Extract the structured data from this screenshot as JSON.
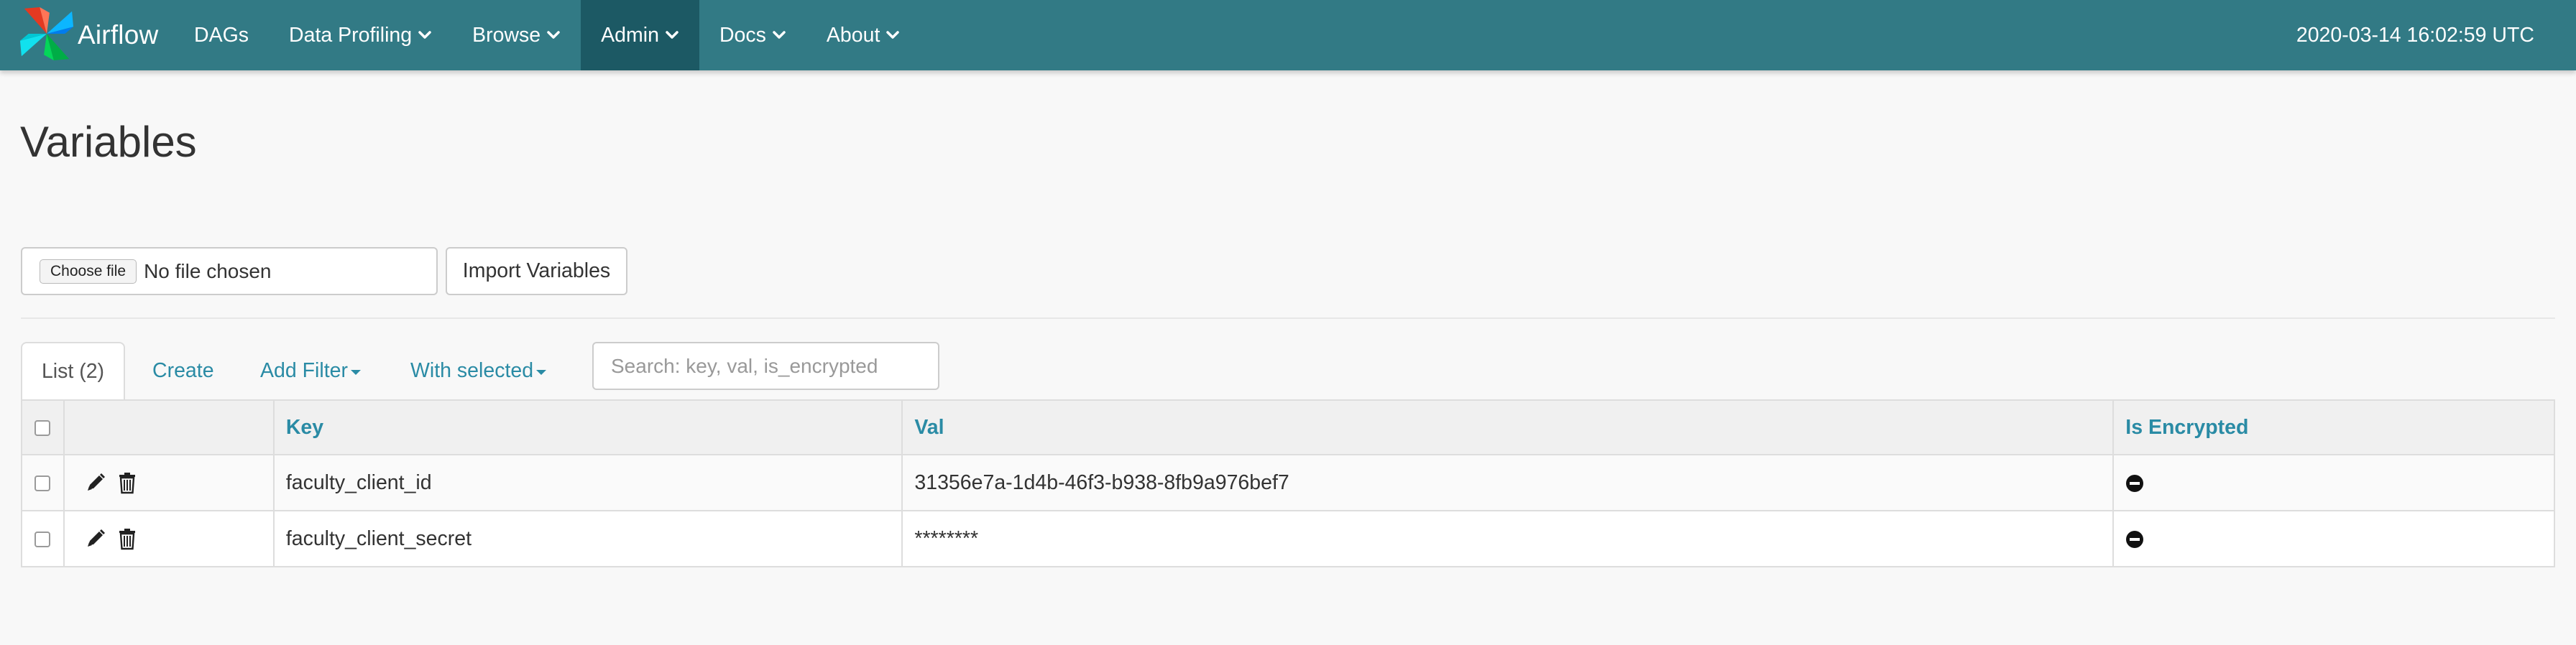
{
  "navbar": {
    "brand": "Airflow",
    "items": [
      {
        "label": "DAGs",
        "dropdown": false,
        "active": false
      },
      {
        "label": "Data Profiling",
        "dropdown": true,
        "active": false
      },
      {
        "label": "Browse",
        "dropdown": true,
        "active": false
      },
      {
        "label": "Admin",
        "dropdown": true,
        "active": true
      },
      {
        "label": "Docs",
        "dropdown": true,
        "active": false
      },
      {
        "label": "About",
        "dropdown": true,
        "active": false
      }
    ],
    "clock": "2020-03-14 16:02:59 UTC"
  },
  "page": {
    "title": "Variables"
  },
  "import": {
    "choose_file": "Choose file",
    "file_status": "No file chosen",
    "import_button": "Import Variables"
  },
  "tabs": {
    "list": "List (2)",
    "create": "Create",
    "add_filter": "Add Filter",
    "with_selected": "With selected"
  },
  "search": {
    "placeholder": "Search: key, val, is_encrypted",
    "value": ""
  },
  "table": {
    "columns": [
      "Key",
      "Val",
      "Is Encrypted"
    ],
    "rows": [
      {
        "key": "faculty_client_id",
        "val": "31356e7a-1d4b-46f3-b938-8fb9a976bef7",
        "is_encrypted_icon": "minus-circle-icon"
      },
      {
        "key": "faculty_client_secret",
        "val": "********",
        "is_encrypted_icon": "minus-circle-icon"
      }
    ]
  },
  "colors": {
    "navbar": "#327a85",
    "navbar_active": "#1c5964",
    "link": "#2a8ba5",
    "page_bg": "#f8f8f8"
  },
  "icons": {
    "logo": "airflow-pinwheel-logo",
    "edit": "pencil-icon",
    "delete": "trash-icon",
    "dropdown": "chevron-down-icon",
    "dropdown_caret": "caret-down-icon"
  }
}
